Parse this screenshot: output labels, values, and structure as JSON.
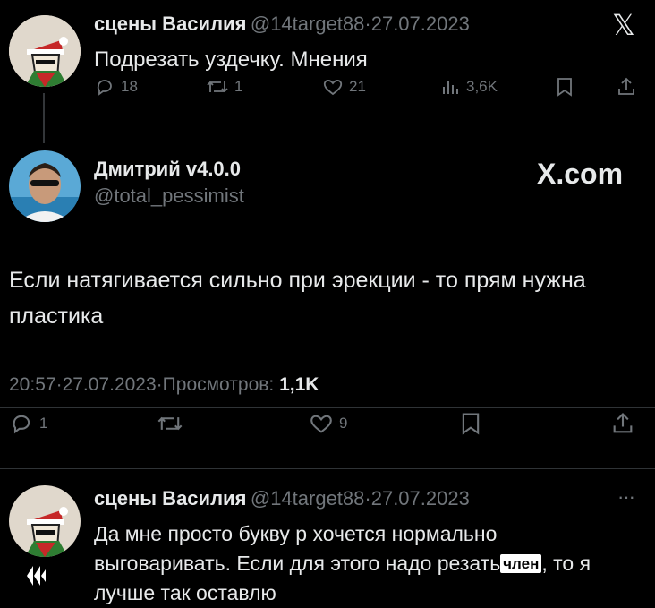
{
  "post1": {
    "author": "сцены Василия",
    "handle": "@14target88",
    "sep": "·",
    "date": "27.07.2023",
    "text": "Подрезать уздечку. Мнения",
    "replies": "18",
    "reposts": "1",
    "likes": "21",
    "views": "3,6K",
    "icons": [
      "reply-icon",
      "repost-icon",
      "like-icon",
      "views-icon",
      "bookmark-icon",
      "share-icon"
    ]
  },
  "x_logo_text": "𝕏",
  "main": {
    "author": "Дмитрий v4.0.0",
    "handle": "@total_pessimist",
    "brand": "X.com",
    "text": "Если натягивается сильно при эрекции - то прям нужна пластика",
    "time": "20:57",
    "sep": "·",
    "date": "27.07.2023",
    "views_label": "Просмотров:",
    "views_value": "1,1K",
    "replies": "1",
    "likes": "9"
  },
  "reply": {
    "author": "сцены Василия",
    "handle": "@14target88",
    "sep": "·",
    "date": "27.07.2023",
    "more": "···",
    "text_before": "Да мне просто букву р хочется нормально выговаривать. Если для этого надо резать",
    "badge": "член",
    "text_after": ", то я лучше так оставлю"
  },
  "colors": {
    "background": "#000000",
    "text": "#e7e9ea",
    "muted": "#71767b",
    "divider": "#2f3336"
  }
}
